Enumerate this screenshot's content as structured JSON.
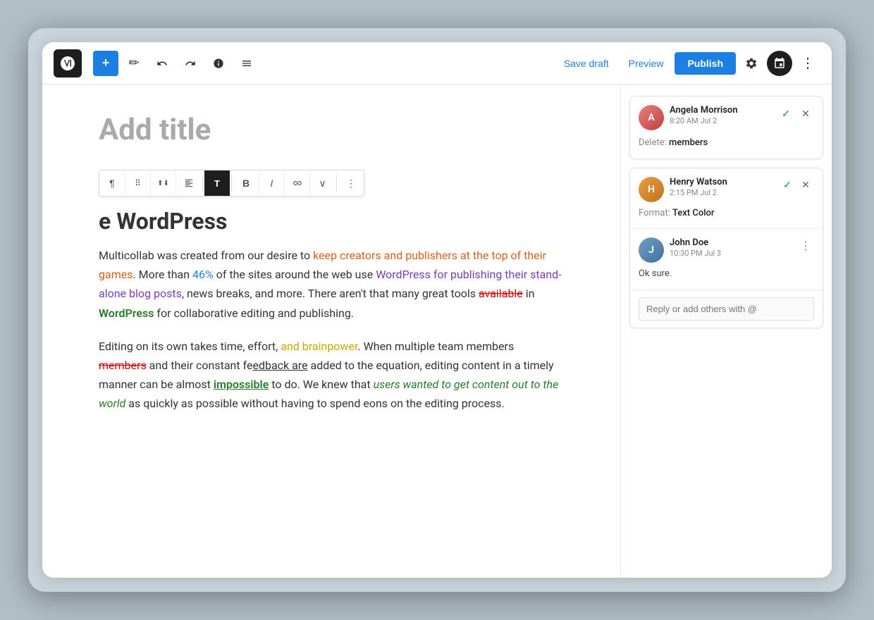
{
  "toolbar": {
    "wp_logo_label": "WordPress",
    "add_label": "+",
    "tools_label": "✎",
    "undo_label": "↩",
    "redo_label": "↪",
    "info_label": "ℹ",
    "list_view_label": "≡",
    "save_draft_label": "Save draft",
    "preview_label": "Preview",
    "publish_label": "Publish",
    "settings_label": "⚙",
    "pin_label": "📌",
    "more_label": "⋮"
  },
  "block_toolbar": {
    "paragraph_label": "¶",
    "drag_label": "⠿",
    "up_down_label": "⬆",
    "align_label": "≡",
    "text_label": "T",
    "bold_label": "B",
    "italic_label": "I",
    "link_label": "⛓",
    "more_options_label": "∨",
    "overflow_label": "⋮"
  },
  "editor": {
    "title_placeholder": "Add title",
    "heading_partial": "e WordPress",
    "paragraph1": {
      "before_link": "Multicollab was created from our desire to ",
      "link_text": "keep creators and publishers at the top of their games",
      "after_link": ". More than ",
      "percent": "46%",
      "after_percent": " of the sites around the web use ",
      "purple_text": "WordPress for publishing their stand-alone blog posts",
      "after_purple": ", news breaks, and more. There aren't that many great tools ",
      "strike_text": "available",
      "after_strike": " in ",
      "wp_text": "WordPress",
      "after_wp": " for collaborative editing and publishing."
    },
    "paragraph2": {
      "before_yellow": "Editing on its own takes time, effort, ",
      "yellow_text": "and brainpower",
      "after_yellow": ". When multiple team members ",
      "red_strike": "members",
      "after_members": " and their constant fe",
      "underline": "edback are",
      "after_underline": " added to the equation, editing content in a timely manner can be almost ",
      "green_ul": "impossible",
      "after_impossible": " to do. We knew that ",
      "green_italic": "users wanted to get content out to the world",
      "after_italic": " as quickly as possible without having to spend eons on the editing process."
    }
  },
  "comments": {
    "card1": {
      "author": "Angela Morrison",
      "time": "8:20 AM Jul 2",
      "label": "Delete: ",
      "value": "members",
      "check_label": "✓",
      "close_label": "✕"
    },
    "card2": {
      "author": "Henry Watson",
      "time": "2:15 PM Jul 2",
      "label": "Format: ",
      "value": "Text Color",
      "check_label": "✓",
      "close_label": "✕"
    },
    "thread": {
      "comment1": {
        "author": "Henry Watson",
        "time": "2:15 PM Jul 2",
        "body": "Format: Text Color"
      },
      "comment2": {
        "author": "John Doe",
        "time": "10:30 PM Jul 3",
        "body": "Ok sure.",
        "dots_label": "⋮"
      },
      "reply_placeholder": "Reply or add others with @"
    }
  },
  "colors": {
    "accent_blue": "#1e7fe2",
    "publish_bg": "#1e7fe2",
    "text_orange": "#d4601a",
    "text_green": "#2b7a2b",
    "text_purple": "#7b3db6",
    "text_red": "#cc0000",
    "text_yellow": "#c9a800"
  }
}
